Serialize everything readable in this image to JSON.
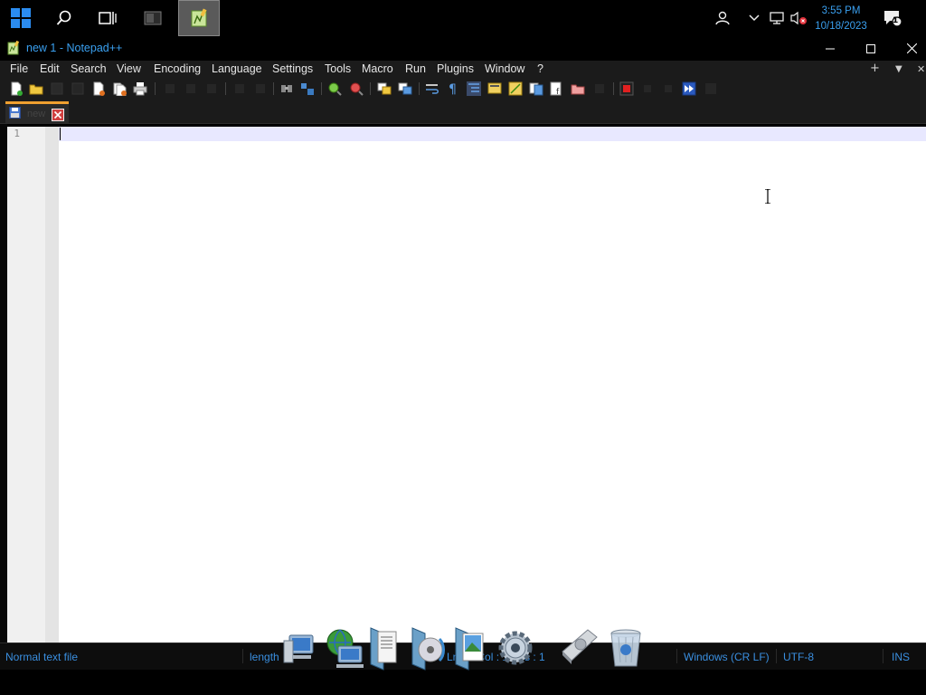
{
  "taskbar": {
    "start_label": "Start",
    "search_label": "Search",
    "taskview_label": "Task View",
    "clock": {
      "time": "3:55 PM",
      "date": "10/18/2023"
    },
    "notification_count": "1"
  },
  "window": {
    "title": "new 1 - Notepad++",
    "controls": {
      "minimize": "—",
      "maximize": "☐",
      "close": "✕"
    }
  },
  "menu": {
    "items": [
      "File",
      "Edit",
      "Search",
      "View",
      "Encoding",
      "Language",
      "Settings",
      "Tools",
      "Macro",
      "Run",
      "Plugins",
      "Window",
      "?"
    ],
    "right": {
      "add": "+",
      "dropdown": "▼",
      "close": "✕"
    }
  },
  "tab": {
    "label": "new"
  },
  "editor": {
    "line_numbers": [
      "1"
    ]
  },
  "status": {
    "file_type": "Normal text file",
    "length": "length",
    "position": "Ln : 1    Col : 1    Pos : 1",
    "eol": "Windows (CR LF)",
    "encoding": "UTF-8",
    "mode": "INS"
  },
  "colors": {
    "accent_blue": "#3aa0f0",
    "tab_indicator": "#f0a030",
    "current_line": "#e8e8ff"
  }
}
